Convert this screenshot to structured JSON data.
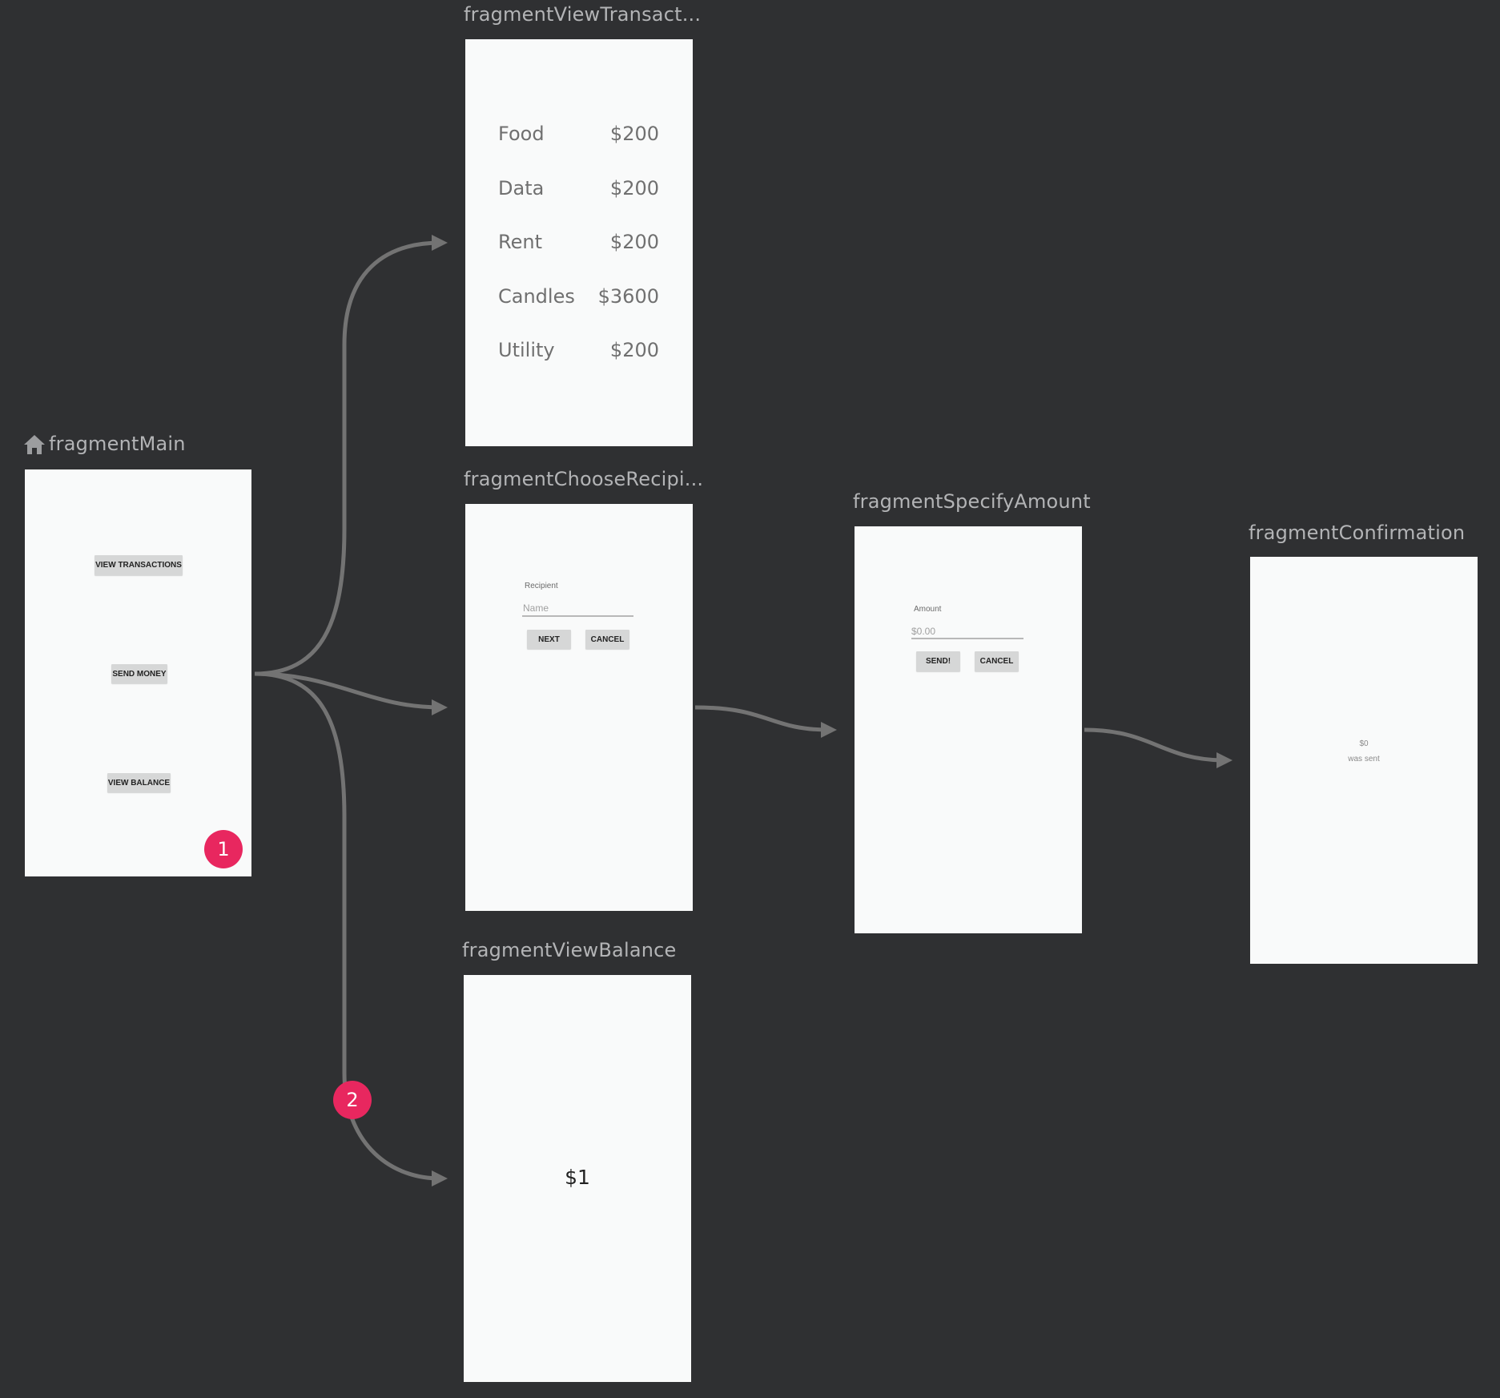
{
  "destinations": {
    "main": {
      "title": "fragmentMain",
      "is_start": true,
      "buttons": [
        "VIEW TRANSACTIONS",
        "SEND MONEY",
        "VIEW BALANCE"
      ]
    },
    "view_transactions": {
      "title": "fragmentViewTransact...",
      "rows": [
        {
          "label": "Food",
          "amount": "$200"
        },
        {
          "label": "Data",
          "amount": "$200"
        },
        {
          "label": "Rent",
          "amount": "$200"
        },
        {
          "label": "Candles",
          "amount": "$3600"
        },
        {
          "label": "Utility",
          "amount": "$200"
        }
      ]
    },
    "choose_recipient": {
      "title": "fragmentChooseRecipi...",
      "field_label": "Recipient",
      "field_hint": "Name",
      "next_label": "NEXT",
      "cancel_label": "CANCEL"
    },
    "specify_amount": {
      "title": "fragmentSpecifyAmount",
      "field_label": "Amount",
      "field_hint": "$0.00",
      "send_label": "SEND!",
      "cancel_label": "CANCEL"
    },
    "confirmation": {
      "title": "fragmentConfirmation",
      "amount": "$0",
      "message": "was sent"
    },
    "view_balance": {
      "title": "fragmentViewBalance",
      "balance": "$1"
    }
  },
  "badges": [
    "1",
    "2"
  ],
  "colors": {
    "background": "#2f3032",
    "connector": "#737373",
    "badge": "#e8275f",
    "frame": "#f9fafa"
  },
  "actions": [
    {
      "from": "fragmentMain",
      "to": "fragmentViewTransactions"
    },
    {
      "from": "fragmentMain",
      "to": "fragmentChooseRecipient"
    },
    {
      "from": "fragmentMain",
      "to": "fragmentViewBalance"
    },
    {
      "from": "fragmentChooseRecipient",
      "to": "fragmentSpecifyAmount"
    },
    {
      "from": "fragmentSpecifyAmount",
      "to": "fragmentConfirmation"
    }
  ]
}
